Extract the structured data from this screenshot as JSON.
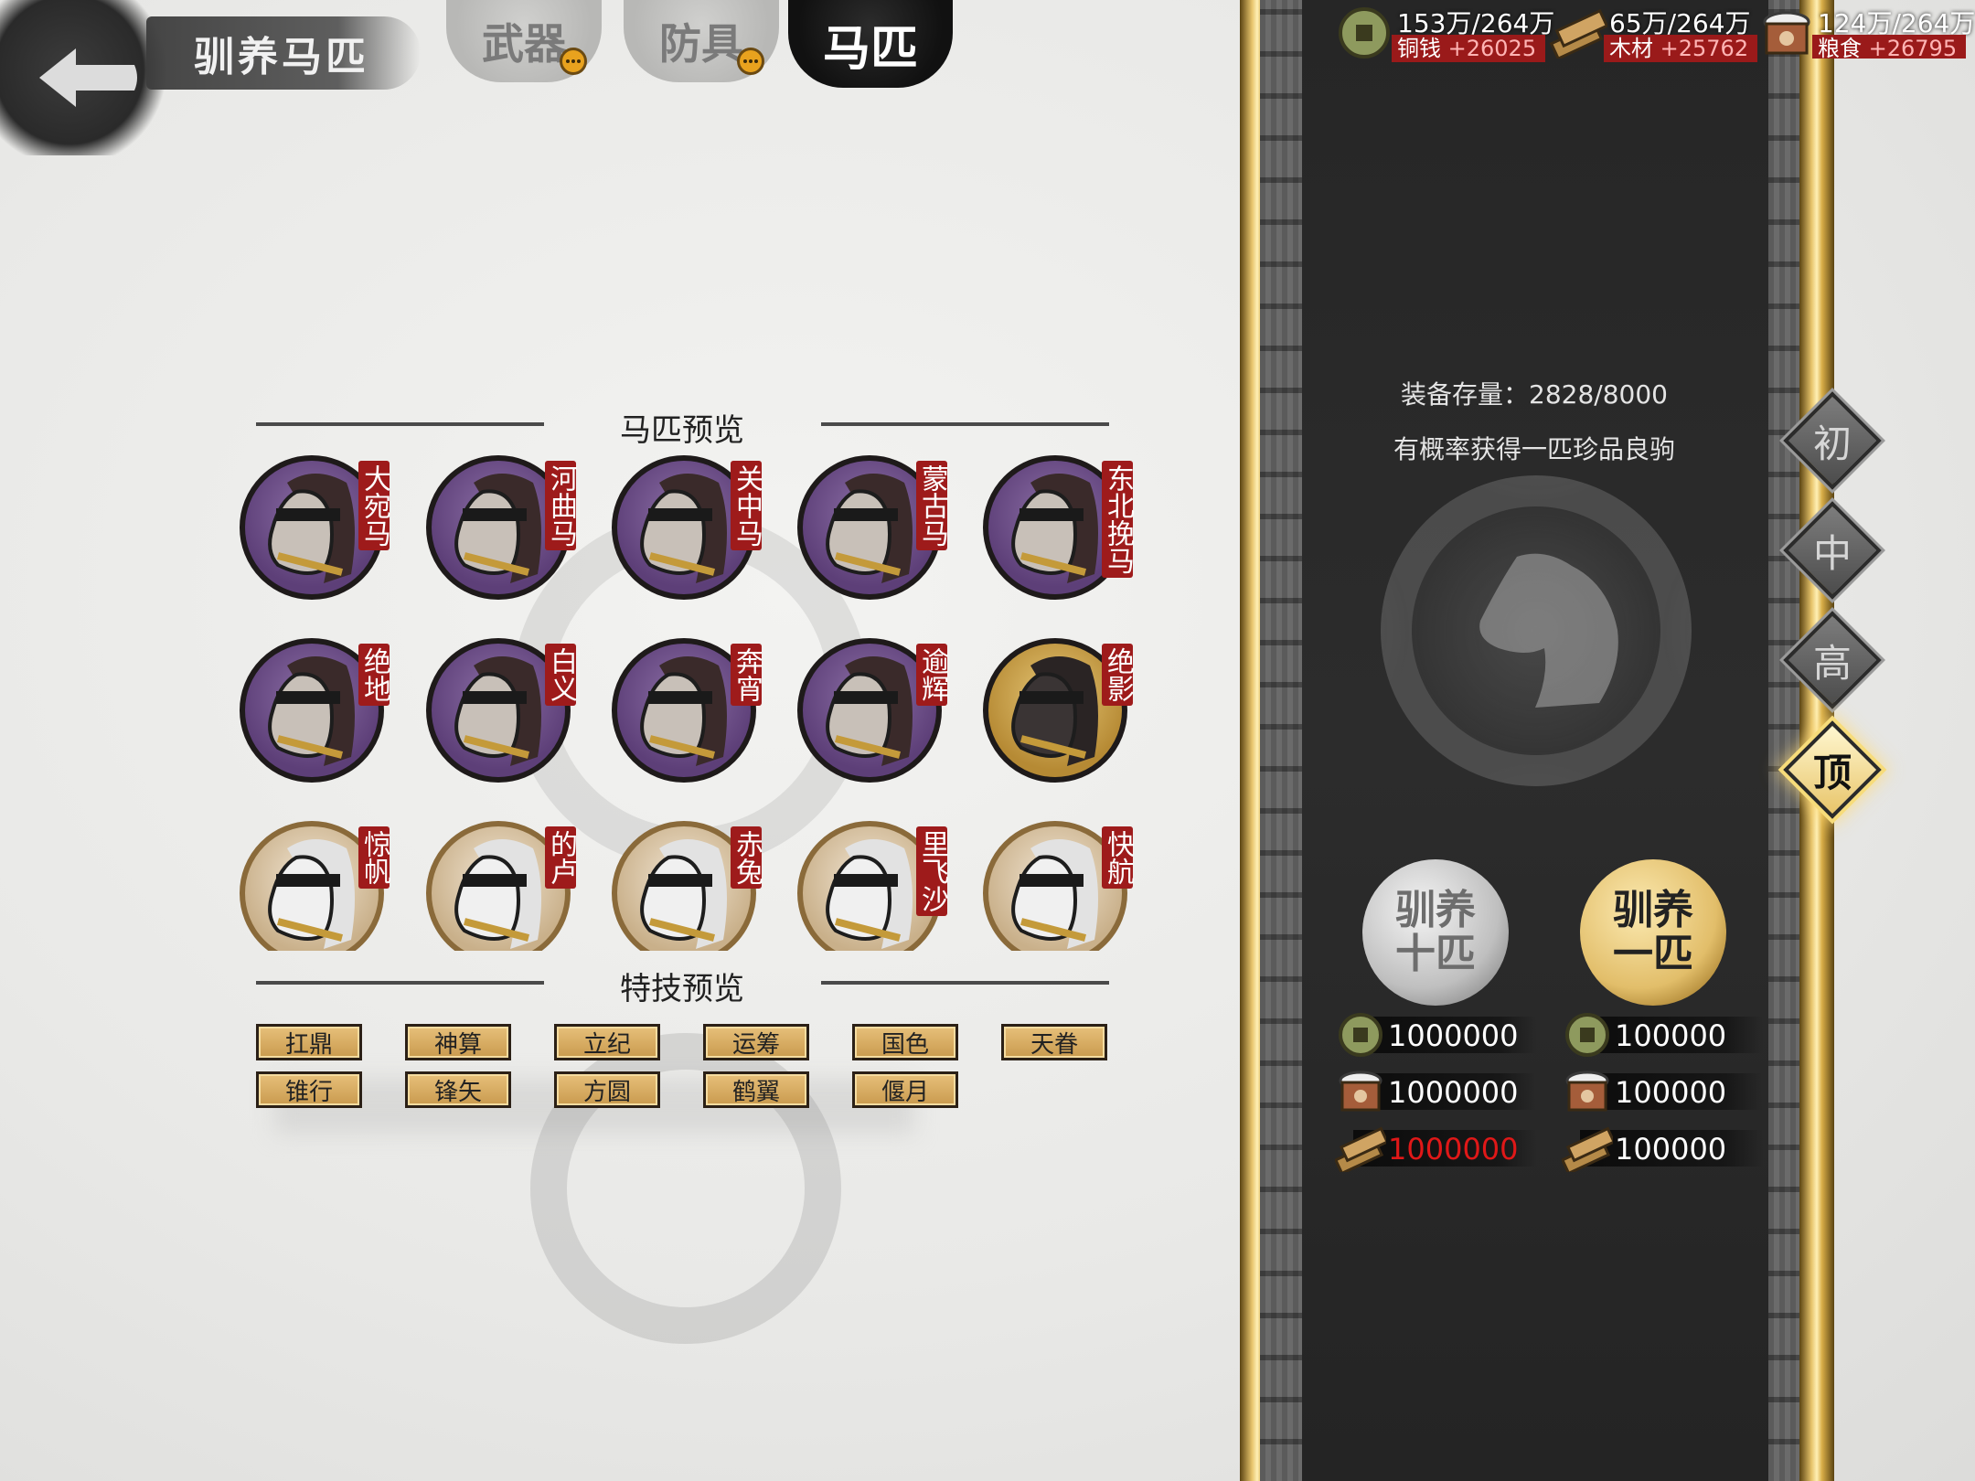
{
  "header": {
    "page_title": "驯养马匹",
    "tabs": [
      {
        "label": "武器",
        "has_notice": true
      },
      {
        "label": "防具",
        "has_notice": true
      },
      {
        "label": "马匹",
        "active": true
      }
    ]
  },
  "preview": {
    "horses_title": "马匹预览",
    "skills_title": "特技预览",
    "horses": [
      {
        "name": "大宛马",
        "medal": "purple"
      },
      {
        "name": "河曲马",
        "medal": "purple"
      },
      {
        "name": "关中马",
        "medal": "purple"
      },
      {
        "name": "蒙古马",
        "medal": "purple"
      },
      {
        "name": "东北挽马",
        "medal": "purple"
      },
      {
        "name": "绝地",
        "medal": "purple"
      },
      {
        "name": "白义",
        "medal": "purple"
      },
      {
        "name": "奔宵",
        "medal": "purple"
      },
      {
        "name": "逾辉",
        "medal": "purple"
      },
      {
        "name": "绝影",
        "medal": "gold"
      },
      {
        "name": "惊帆",
        "medal": "white"
      },
      {
        "name": "的卢",
        "medal": "white"
      },
      {
        "name": "赤兔",
        "medal": "white"
      },
      {
        "name": "里飞沙",
        "medal": "white"
      },
      {
        "name": "快航",
        "medal": "white"
      }
    ],
    "skills": [
      "扛鼎",
      "神算",
      "立纪",
      "运筹",
      "国色",
      "天眷",
      "锥行",
      "锋矢",
      "方圆",
      "鹤翼",
      "偃月"
    ]
  },
  "resources": [
    {
      "name": "铜钱",
      "amount": "153万/264万",
      "rate": "+26025",
      "icon": "coin-icon"
    },
    {
      "name": "木材",
      "amount": "65万/264万",
      "rate": "+25762",
      "icon": "wood-icon"
    },
    {
      "name": "粮食",
      "amount": "124万/264万",
      "rate": "+26795",
      "icon": "grain-icon"
    }
  ],
  "panel": {
    "storage_text": "装备存量：2828/8000",
    "hint_text": "有概率获得一匹珍品良驹",
    "tiers": [
      {
        "label": "初",
        "active": false
      },
      {
        "label": "中",
        "active": false
      },
      {
        "label": "高",
        "active": false
      },
      {
        "label": "顶",
        "active": true
      }
    ],
    "train_ten": {
      "label_line1": "驯养",
      "label_line2": "十匹",
      "costs": [
        {
          "icon": "coin-icon",
          "value": "1000000",
          "insufficient": false
        },
        {
          "icon": "grain-icon",
          "value": "1000000",
          "insufficient": false
        },
        {
          "icon": "wood-icon",
          "value": "1000000",
          "insufficient": true
        }
      ]
    },
    "train_one": {
      "label_line1": "驯养",
      "label_line2": "一匹",
      "costs": [
        {
          "icon": "coin-icon",
          "value": "100000",
          "insufficient": false
        },
        {
          "icon": "grain-icon",
          "value": "100000",
          "insufficient": false
        },
        {
          "icon": "wood-icon",
          "value": "100000",
          "insufficient": false
        }
      ]
    }
  },
  "colors": {
    "tag_red": "#9e1b1b",
    "gold": "#e7c46b",
    "panel_dark": "#262626"
  }
}
